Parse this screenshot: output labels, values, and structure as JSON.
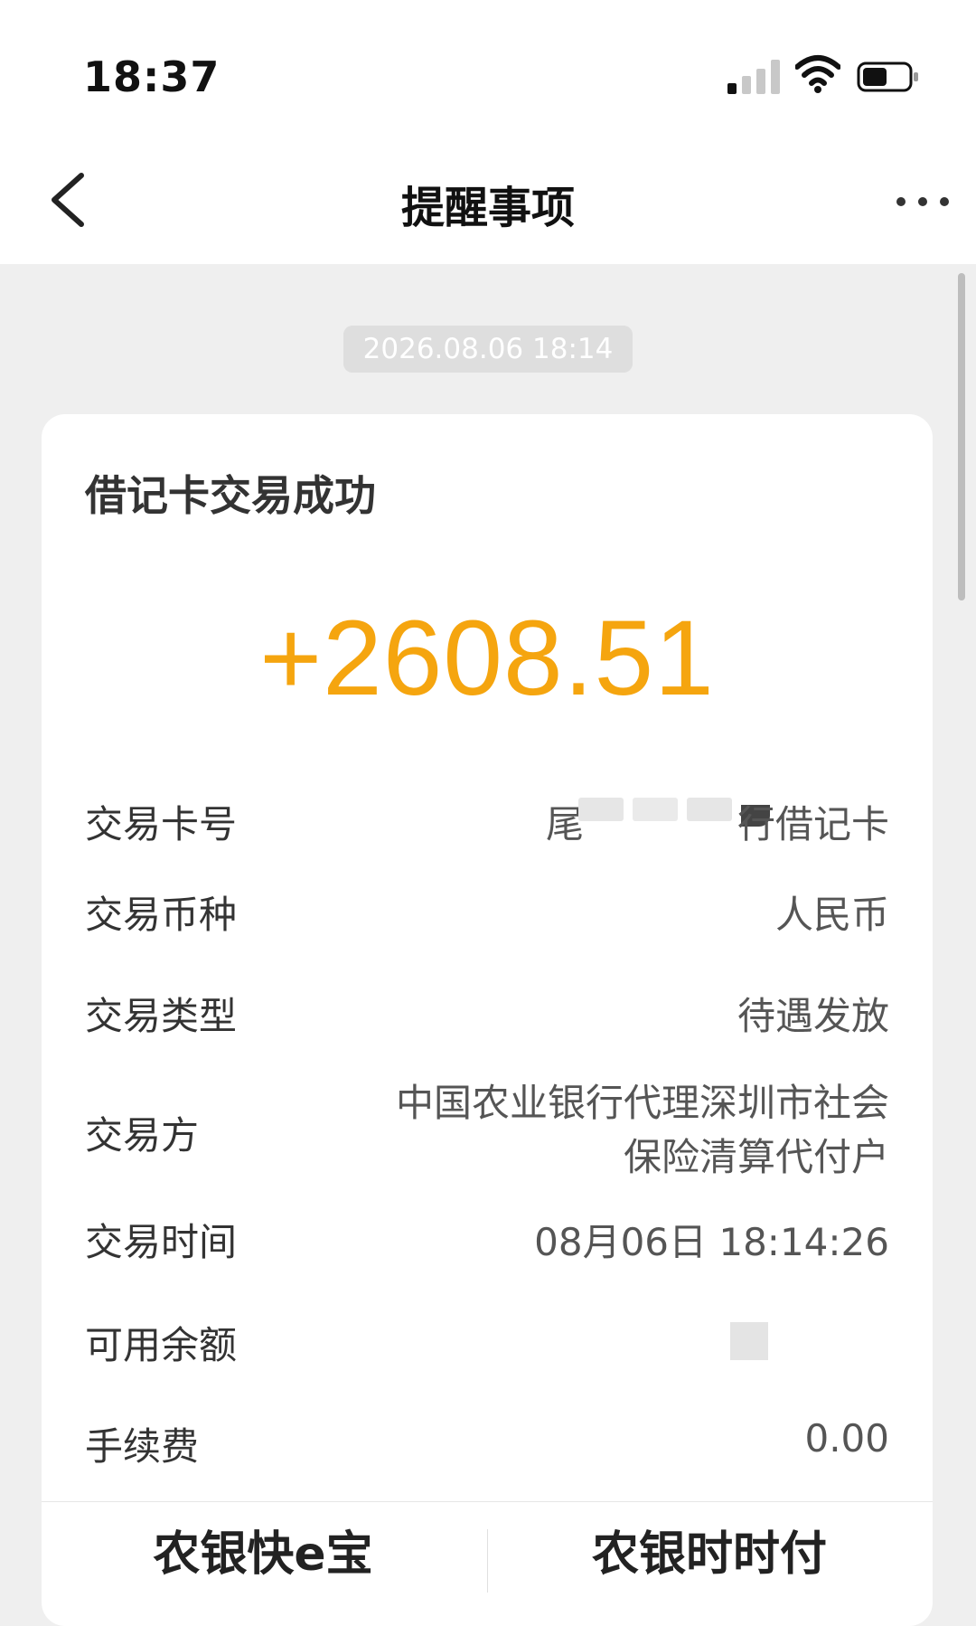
{
  "status_bar": {
    "time": "18:37"
  },
  "nav": {
    "title": "提醒事项"
  },
  "timestamp": "2026.08.06 18:14",
  "card": {
    "title": "借记卡交易成功",
    "amount": "+2608.51",
    "amount_color": "#f5a50f",
    "rows": [
      {
        "label": "交易卡号",
        "value_prefix": "尾",
        "value_suffix": "行借记卡"
      },
      {
        "label": "交易币种",
        "value": "人民币"
      },
      {
        "label": "交易类型",
        "value": "待遇发放"
      },
      {
        "label": "交易方",
        "value_line1": "中国农业银行代理深圳市社会",
        "value_line2": "保险清算代付户"
      },
      {
        "label": "交易时间",
        "value": "08月06日 18:14:26"
      },
      {
        "label": "可用余额",
        "value": ""
      },
      {
        "label": "手续费",
        "value": "0.00"
      }
    ]
  },
  "bottom_buttons": {
    "left": "农银快e宝",
    "right": "农银时时付"
  }
}
